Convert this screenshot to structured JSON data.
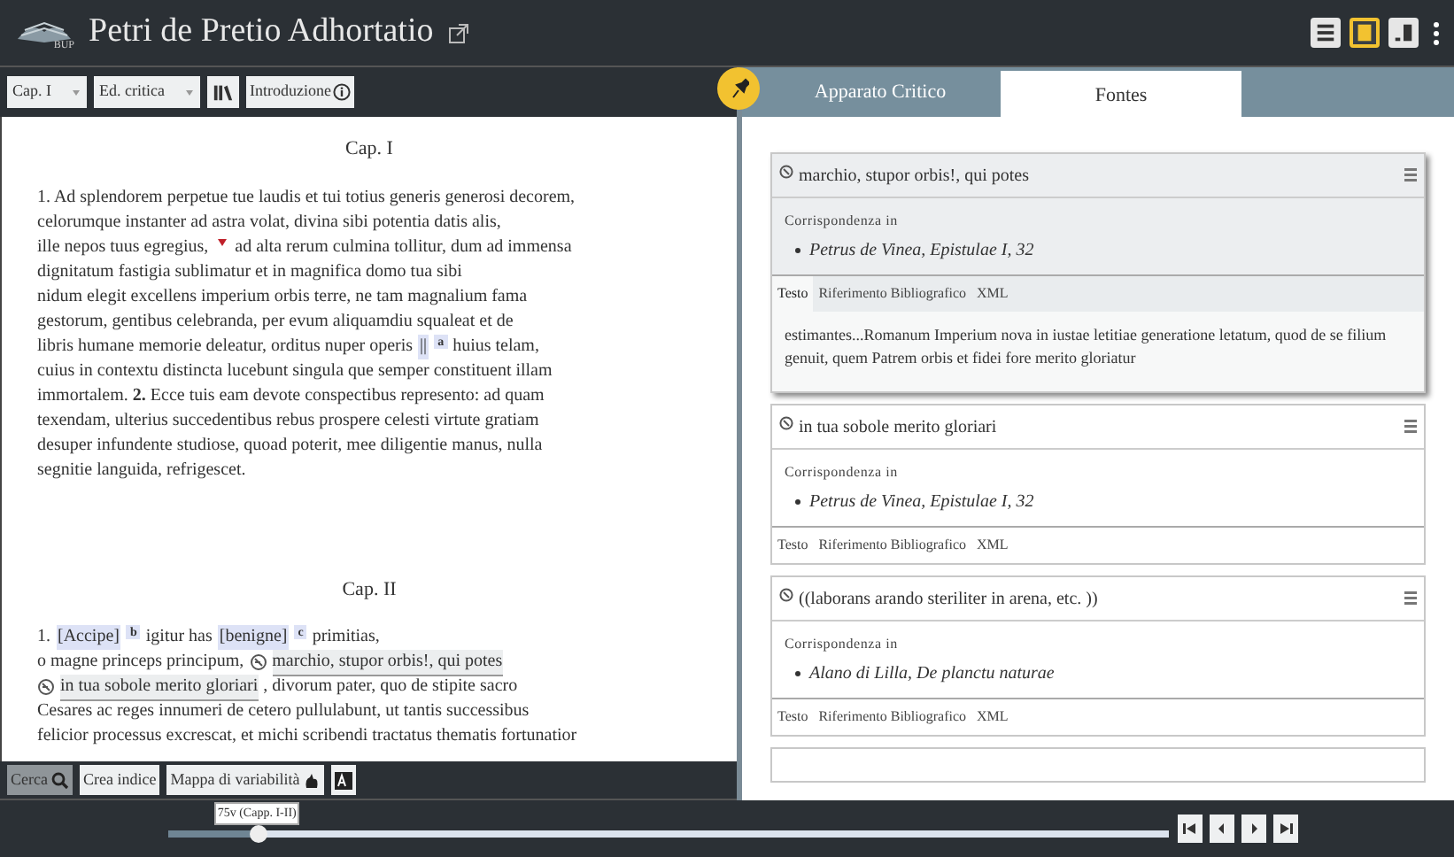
{
  "header": {
    "title": "Petri de Pretio Adhortatio",
    "logo_caption": "BUP",
    "views": [
      {
        "selected": false
      },
      {
        "selected": true
      },
      {
        "selected": false
      }
    ]
  },
  "left_toolbar": {
    "chapter": "Cap. I",
    "edition": "Ed. critica",
    "intro": "Introduzione"
  },
  "text": [
    {
      "heading": "Cap. I",
      "lines": [
        [
          {
            "kind": "text",
            "text": "1. Ad splendorem perpetue tue laudis et tui totius generis generosi decorem,"
          }
        ],
        [
          {
            "kind": "text",
            "text": "celorumque instanter ad astra volat, divina sibi potentia datis alis,"
          }
        ],
        [
          {
            "kind": "text",
            "text": "ille nepos tuus egregius,"
          },
          {
            "kind": "note"
          },
          {
            "kind": "text",
            "text": "ad alta rerum culmina tollitur, dum ad immensa"
          }
        ],
        [
          {
            "kind": "text",
            "text": "dignitatum fastigia sublimatur et in magnifica domo tua sibi"
          }
        ],
        [
          {
            "kind": "text",
            "text": "nidum elegit excellens imperium orbis terre, ne tam magnalium fama"
          }
        ],
        [
          {
            "kind": "text",
            "text": "gestorum, gentibus celebranda, per evum aliquamdiu squaleat et de"
          }
        ],
        [
          {
            "kind": "text",
            "text": "libris humane memorie deleatur, orditus nuper operis"
          },
          {
            "kind": "variant",
            "text": "||",
            "sup": "a"
          },
          {
            "kind": "text",
            "text": "huius telam,"
          }
        ],
        [
          {
            "kind": "text",
            "text": "cuius in contextu distincta lucebunt singula que semper constituent illam"
          }
        ],
        [
          {
            "kind": "text",
            "text": "immortalem. **2.** Ecce tuis eam devote conspectibus represento: ad quam"
          }
        ],
        [
          {
            "kind": "text",
            "text": "texendam, ulterius succedentibus rebus prospere celesti virtute gratiam"
          }
        ],
        [
          {
            "kind": "text",
            "text": "desuper infundente studiose, quoad poterit, mee diligentie manus, nulla"
          }
        ],
        [
          {
            "kind": "text",
            "text": "segnitie languida, refrigescet."
          }
        ]
      ]
    },
    {
      "heading": "Cap. II",
      "lines": [
        [
          {
            "kind": "text",
            "text": "1."
          },
          {
            "kind": "variant",
            "text": "[Accipe]",
            "sup": "b"
          },
          {
            "kind": "text",
            "text": "igitur has"
          },
          {
            "kind": "variant",
            "text": "[benigne]",
            "sup": "c"
          },
          {
            "kind": "text",
            "text": "primitias,"
          }
        ],
        [
          {
            "kind": "text",
            "text": "o magne princeps principum,"
          },
          {
            "kind": "source",
            "text": "marchio, stupor orbis!, qui potes"
          }
        ],
        [
          {
            "kind": "source",
            "text": "in tua sobole merito gloriari"
          },
          {
            "kind": "text",
            "text": ", divorum pater, quo de stipite sacro"
          }
        ],
        [
          {
            "kind": "text",
            "text": "Cesares ac reges innumeri de cetero pullulabunt, ut tantis successibus"
          }
        ],
        [
          {
            "kind": "text",
            "text": "felicior processus excrescat, et michi scribendi tractatus thematis fortunatior"
          }
        ]
      ]
    }
  ],
  "bottom_toolbar": [
    {
      "kind": "search",
      "label": "Cerca",
      "selected": true
    },
    {
      "kind": "plain",
      "label": "Crea indice",
      "selected": false
    },
    {
      "kind": "heatmap",
      "label": "Mappa di variabilità",
      "selected": false
    },
    {
      "kind": "font",
      "selected": false
    }
  ],
  "pager": {
    "tooltip": "75v (Capp. I-II)",
    "level": 0.09
  },
  "tabs": [
    {
      "label": "Apparato Critico",
      "selected": false
    },
    {
      "label": "Fontes",
      "selected": true
    }
  ],
  "sources": [
    {
      "title": "marchio, stupor orbis!, qui potes",
      "selected": true,
      "heading": "Corrispondenza in",
      "refs": [
        "Petrus de Vinea, Epistulae I, 32"
      ],
      "tabs": [
        {
          "label": "Testo",
          "selected": true
        },
        {
          "label": "Riferimento Bibliografico",
          "selected": false
        },
        {
          "label": "XML",
          "selected": false
        }
      ],
      "body": "estimantes...Romanum Imperium nova in iustae letitiae generatione letatum, quod de se filium genuit, quem Patrem orbis et fidei fore merito gloriatur"
    },
    {
      "title": "in tua sobole merito gloriari",
      "selected": false,
      "heading": "Corrispondenza in",
      "refs": [
        "Petrus de Vinea, Epistulae I, 32"
      ],
      "tabs": [
        {
          "label": "Testo",
          "selected": false
        },
        {
          "label": "Riferimento Bibliografico",
          "selected": false
        },
        {
          "label": "XML",
          "selected": false
        }
      ]
    },
    {
      "title": "((laborans arando steriliter in arena, etc. ))",
      "selected": false,
      "heading": "Corrispondenza in",
      "refs": [
        "Alano di Lilla, De planctu naturae"
      ],
      "tabs": [
        {
          "label": "Testo",
          "selected": false
        },
        {
          "label": "Riferimento Bibliografico",
          "selected": false
        },
        {
          "label": "XML",
          "selected": false
        }
      ]
    }
  ]
}
